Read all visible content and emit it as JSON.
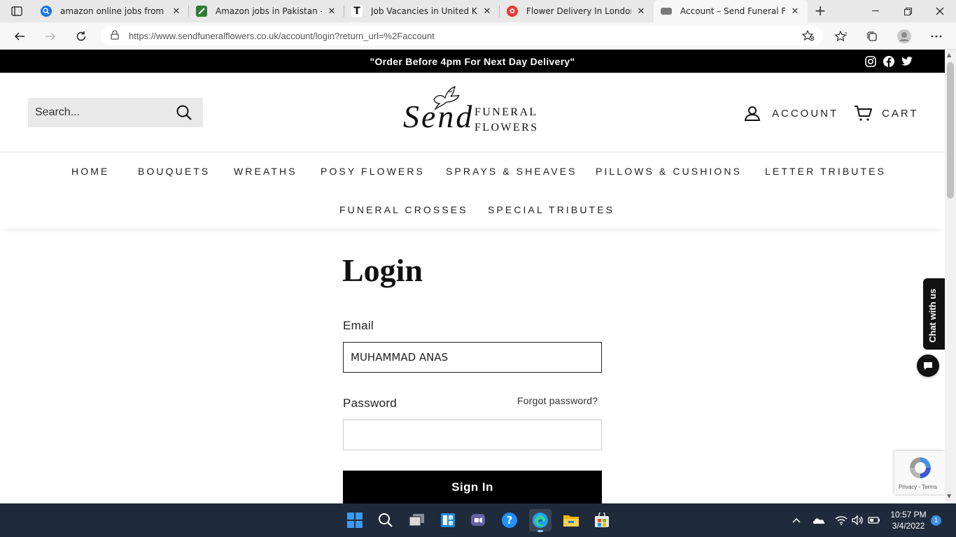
{
  "browser": {
    "tabs": [
      {
        "title": "amazon online jobs from hom",
        "favicon_color": "#1a73e8",
        "icon": "search-favicon-icon"
      },
      {
        "title": "Amazon jobs in Pakistan - RC",
        "favicon_color": "#2e7d32",
        "icon": "rozee-favicon-icon"
      },
      {
        "title": "Job Vacancies in United Kingd",
        "favicon_color": "#111111",
        "icon": "totaljobs-favicon-icon"
      },
      {
        "title": "Flower Delivery In London Uk",
        "favicon_color": "#e53935",
        "icon": "flower-favicon-icon"
      },
      {
        "title": "Account – Send Funeral Flowe",
        "favicon_color": "#7a7a7a",
        "icon": "site-favicon-icon"
      }
    ],
    "url": "https://www.sendfuneralflowers.co.uk/account/login?return_url=%2Faccount"
  },
  "site": {
    "announcement": "\"Order Before 4pm For Next Day Delivery\"",
    "search_placeholder": "Search...",
    "logo_text": "Send",
    "logo_sub_1": "FUNERAL",
    "logo_sub_2": "FLOWERS",
    "account_label": "ACCOUNT",
    "cart_label": "CART",
    "menu": [
      "HOME",
      "BOUQUETS",
      "WREATHS",
      "POSY FLOWERS",
      "SPRAYS & SHEAVES",
      "PILLOWS & CUSHIONS",
      "LETTER TRIBUTES",
      "FUNERAL CROSSES",
      "SPECIAL TRIBUTES"
    ]
  },
  "login": {
    "title": "Login",
    "email_label": "Email",
    "email_value": "MUHAMMAD ANAS",
    "password_label": "Password",
    "forgot_label": "Forgot password?",
    "signin_label": "Sign In"
  },
  "widgets": {
    "chat_label": "Chat with us",
    "recaptcha_terms": "Privacy - Terms"
  },
  "taskbar": {
    "time": "10:57 PM",
    "date": "3/4/2022",
    "notifications": "1"
  }
}
